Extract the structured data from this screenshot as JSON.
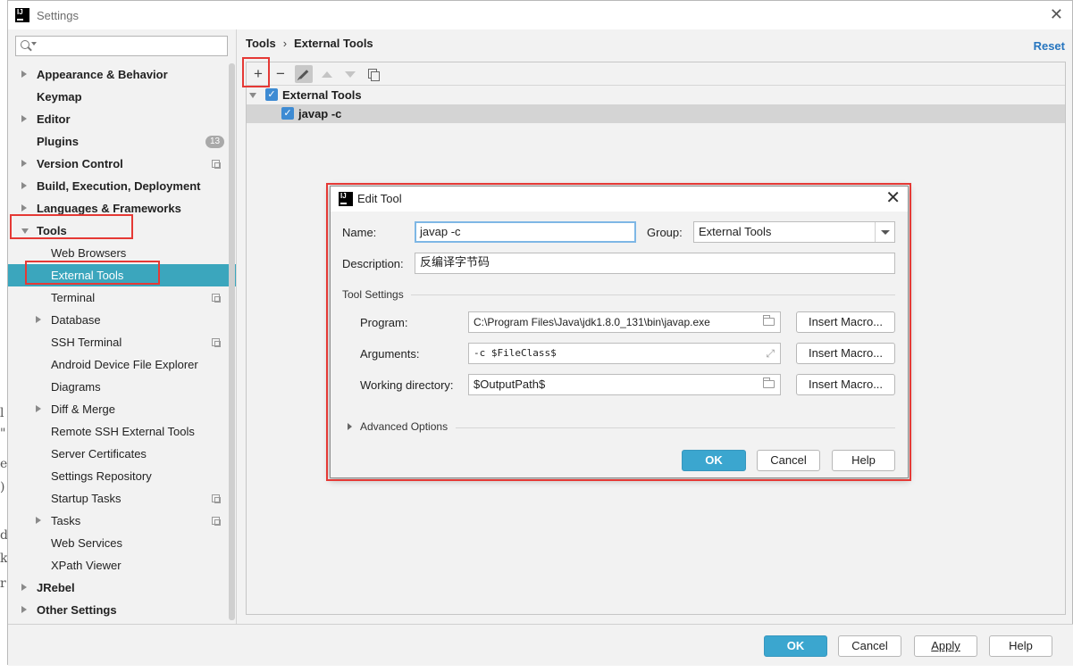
{
  "window": {
    "title": "Settings",
    "close_glyph": "✕"
  },
  "search": {
    "placeholder": ""
  },
  "sidebar": {
    "items": [
      {
        "label": "Appearance & Behavior",
        "level": "top",
        "arrow": "right"
      },
      {
        "label": "Keymap",
        "level": "top"
      },
      {
        "label": "Editor",
        "level": "top",
        "arrow": "right"
      },
      {
        "label": "Plugins",
        "level": "top",
        "badge": "13"
      },
      {
        "label": "Version Control",
        "level": "top",
        "arrow": "right",
        "icon": "copy-icon"
      },
      {
        "label": "Build, Execution, Deployment",
        "level": "top",
        "arrow": "right"
      },
      {
        "label": "Languages & Frameworks",
        "level": "top",
        "arrow": "right"
      },
      {
        "label": "Tools",
        "level": "top",
        "arrow": "down"
      },
      {
        "label": "Web Browsers",
        "level": "sub"
      },
      {
        "label": "External Tools",
        "level": "sub",
        "selected": true
      },
      {
        "label": "Terminal",
        "level": "sub",
        "icon": "copy-icon"
      },
      {
        "label": "Database",
        "level": "sub",
        "arrow": "right"
      },
      {
        "label": "SSH Terminal",
        "level": "sub",
        "icon": "copy-icon"
      },
      {
        "label": "Android Device File Explorer",
        "level": "sub"
      },
      {
        "label": "Diagrams",
        "level": "sub"
      },
      {
        "label": "Diff & Merge",
        "level": "sub",
        "arrow": "right"
      },
      {
        "label": "Remote SSH External Tools",
        "level": "sub"
      },
      {
        "label": "Server Certificates",
        "level": "sub"
      },
      {
        "label": "Settings Repository",
        "level": "sub"
      },
      {
        "label": "Startup Tasks",
        "level": "sub",
        "icon": "copy-icon"
      },
      {
        "label": "Tasks",
        "level": "sub",
        "arrow": "right",
        "icon": "copy-icon"
      },
      {
        "label": "Web Services",
        "level": "sub"
      },
      {
        "label": "XPath Viewer",
        "level": "sub"
      },
      {
        "label": "JRebel",
        "level": "top",
        "arrow": "right"
      },
      {
        "label": "Other Settings",
        "level": "top",
        "arrow": "right"
      }
    ]
  },
  "breadcrumb": {
    "parent": "Tools",
    "separator": "›",
    "current": "External Tools"
  },
  "reset_label": "Reset",
  "toolbar": {
    "add": "+",
    "remove": "−"
  },
  "tools_tree": {
    "group": "External Tools",
    "item": "javap -c",
    "check": "✓"
  },
  "dialog": {
    "title": "Edit Tool",
    "close_glyph": "✕",
    "name_label": "Name:",
    "name_value": "javap -c",
    "group_label": "Group:",
    "group_value": "External Tools",
    "description_label": "Description:",
    "description_value": "反编译字节码",
    "tool_settings_label": "Tool Settings",
    "program_label": "Program:",
    "program_value": "C:\\Program Files\\Java\\jdk1.8.0_131\\bin\\javap.exe",
    "arguments_label": "Arguments:",
    "arguments_value": "-c $FileClass$",
    "workdir_label": "Working directory:",
    "workdir_value": "$OutputPath$",
    "insert_macro_label": "Insert Macro...",
    "advanced_label": "Advanced Options",
    "ok_label": "OK",
    "cancel_label": "Cancel",
    "help_label": "Help"
  },
  "footer": {
    "ok_label": "OK",
    "cancel_label": "Cancel",
    "apply_label": "Apply",
    "help_label": "Help"
  },
  "colors": {
    "accent": "#3ba6bd",
    "highlight_box": "#e53935",
    "link": "#2675bf",
    "checkbox": "#3e8bd3"
  }
}
